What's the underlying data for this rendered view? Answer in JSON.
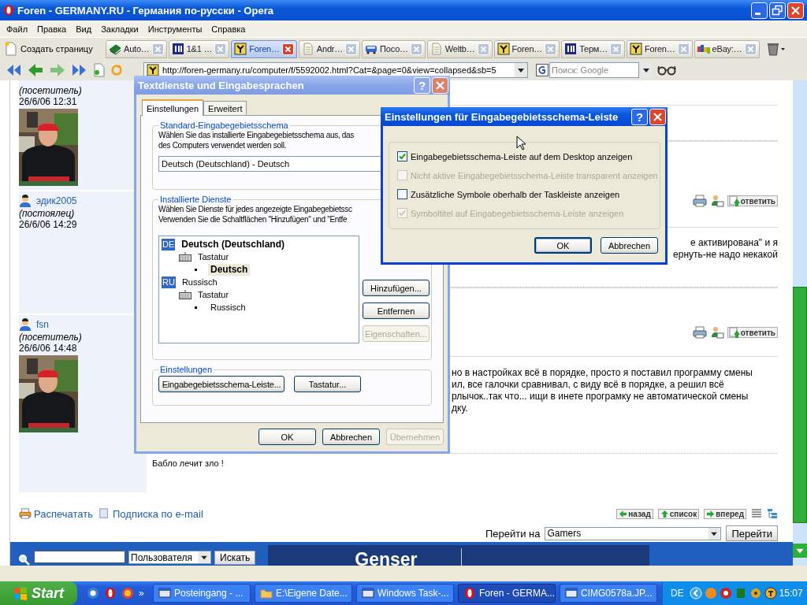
{
  "window": {
    "title": "Foren - GERMANY.RU - Германия по-русски - Opera"
  },
  "menu": [
    "Файл",
    "Правка",
    "Вид",
    "Закладки",
    "Инструменты",
    "Справка"
  ],
  "tab_bar": {
    "new_page": "Создать страницу",
    "tabs": [
      {
        "label": "Auto…",
        "kind": "book",
        "selected": false
      },
      {
        "label": "1&1 …",
        "kind": "square",
        "selected": false
      },
      {
        "label": "Foren…",
        "kind": "forum",
        "selected": true
      },
      {
        "label": "Andr…",
        "kind": "page",
        "selected": false
      },
      {
        "label": "Посо…",
        "kind": "bus",
        "selected": false
      },
      {
        "label": "Weltb…",
        "kind": "page",
        "selected": false
      },
      {
        "label": "Foren…",
        "kind": "forum",
        "selected": false
      },
      {
        "label": "Терм…",
        "kind": "square",
        "selected": false
      },
      {
        "label": "Foren…",
        "kind": "forum",
        "selected": false
      },
      {
        "label": "eBay:…",
        "kind": "shop",
        "selected": false
      }
    ]
  },
  "address_bar": {
    "url": "http://foren-germany.ru/computer/f/5592002.html?Cat=&page=0&view=collapsed&sb=5",
    "search_placeholder": "Поиск: Google"
  },
  "posts": [
    {
      "role": "(посетитель)",
      "date": "26/6/06 12:31",
      "avatar": true
    },
    {
      "user": "эдик2005",
      "role": "(постоялец)",
      "date": "26/6/06 14:29",
      "avatar": false,
      "reply": "ответить",
      "lines": [
        "е активирована\" и я",
        "ернуть-не надо некакой"
      ]
    },
    {
      "user": "fsn",
      "role": "(посетитель)",
      "date": "26/6/06 14:48",
      "avatar": true,
      "reply": "ответить",
      "lines": [
        "но в настройках всё в порядке, просто я поставил программу смены",
        "ил, все галочки сравнивал, с виду всё в порядке, а решил всё",
        "рлычок..так что... ищи в инете програмку не автоматической смены",
        "дку."
      ],
      "signature": "Бабло лечит зло !"
    }
  ],
  "footer": {
    "print": "Распечатать",
    "subscribe": "Подписка по e-mail",
    "nav": [
      "назад",
      "список",
      "вперед"
    ],
    "jump_label": "Перейти на",
    "jump_value": "Gamers",
    "jump_button": "Перейти"
  },
  "search_bar": {
    "scope": "Пользователя",
    "button": "Искать",
    "banner": "Genser"
  },
  "dialog_text_services": {
    "title": "Textdienste und Eingabesprachen",
    "help": "?",
    "tabs": [
      {
        "label": "Einstellungen",
        "selected": true
      },
      {
        "label": "Erweitert",
        "selected": false
      }
    ],
    "default_group": {
      "legend": "Standard-Eingabegebietsschema",
      "lines": [
        "Wählen Sie das installierte Eingabegebietsschema aus, das",
        "des Computers verwendet werden soll."
      ],
      "value": "Deutsch (Deutschland) - Deutsch"
    },
    "services_group": {
      "legend": "Installierte Dienste",
      "lines": [
        "Wählen Sie Dienste für jedes angezeigte Eingabegebietssc",
        "Verwenden Sie die Schaltflächen \"Hinzufügen\" und \"Entfe"
      ],
      "tree": [
        {
          "code": "DE",
          "label": "Deutsch (Deutschland)",
          "default": true,
          "children": [
            {
              "label": "Tastatur",
              "children": [
                {
                  "label": "Deutsch",
                  "default": true,
                  "selected": true
                }
              ]
            }
          ]
        },
        {
          "code": "RU",
          "label": "Russisch",
          "default": false,
          "children": [
            {
              "label": "Tastatur",
              "children": [
                {
                  "label": "Russisch",
                  "default": false,
                  "selected": false
                }
              ]
            }
          ]
        }
      ],
      "buttons": [
        {
          "label": "Hinzufügen...",
          "disabled": false
        },
        {
          "label": "Entfernen",
          "disabled": false
        },
        {
          "label": "Eigenschaften...",
          "disabled": true
        }
      ]
    },
    "settings_group": {
      "legend": "Einstellungen",
      "buttons": [
        "Eingabegebietsschema-Leiste...",
        "Tastatur..."
      ]
    },
    "buttons": [
      {
        "label": "OK",
        "disabled": false
      },
      {
        "label": "Abbrechen",
        "disabled": false
      },
      {
        "label": "Übernehmen",
        "disabled": true
      }
    ]
  },
  "dialog_language_bar": {
    "title": "Einstellungen für Eingabegebietsschema-Leiste",
    "help": "?",
    "options": [
      {
        "label": "Eingabegebietsschema-Leiste auf dem Desktop anzeigen",
        "checked": true,
        "disabled": false
      },
      {
        "label": "Nicht aktive Eingabegebietsschema-Leiste transparent anzeigen",
        "checked": false,
        "disabled": true
      },
      {
        "label": "Zusätzliche Symbole oberhalb der Taskleiste anzeigen",
        "checked": false,
        "disabled": false
      },
      {
        "label": "Symboltitel auf Eingabegebietsschema-Leiste anzeigen",
        "checked": true,
        "disabled": true
      }
    ],
    "buttons": [
      {
        "label": "OK",
        "default": true
      },
      {
        "label": "Abbrechen",
        "default": false
      }
    ]
  },
  "taskbar": {
    "start": "Start",
    "more": "»",
    "tasks": [
      {
        "label": "Posteingang - ...",
        "selected": false
      },
      {
        "label": "E:\\Eigene Date...",
        "selected": false
      },
      {
        "label": "Windows Task-...",
        "selected": false
      },
      {
        "label": "Foren - GERMA...",
        "selected": true
      },
      {
        "label": "CIMG0578a.JP...",
        "selected": false
      }
    ],
    "language": "DE",
    "clock": "15:07"
  }
}
